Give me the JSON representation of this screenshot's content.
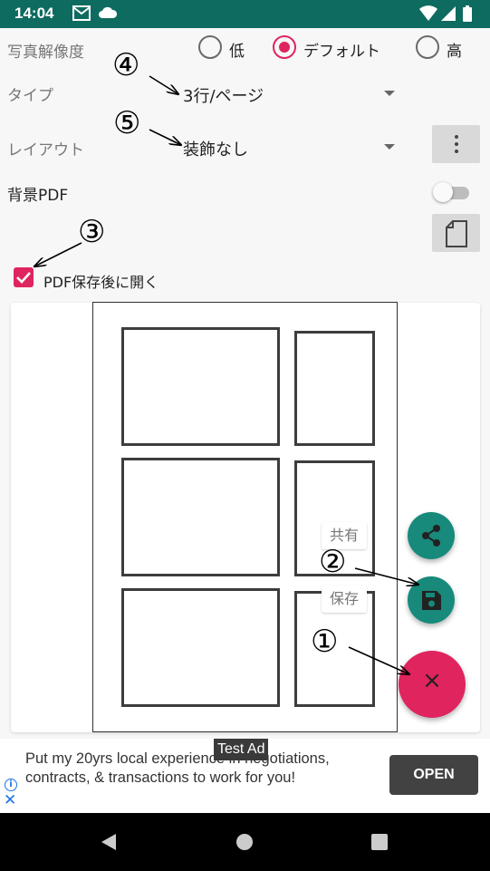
{
  "status_bar": {
    "time": "14:04"
  },
  "photo_resolution": {
    "label": "写真解像度",
    "options": [
      "低",
      "デフォルト",
      "高"
    ],
    "selected": "デフォルト"
  },
  "type_row": {
    "label": "タイプ",
    "value": "3行/ページ"
  },
  "layout_row": {
    "label": "レイアウト",
    "value": "装飾なし"
  },
  "background_pdf": {
    "label": "背景PDF",
    "enabled": false
  },
  "open_after_save": {
    "label": "PDF保存後に開く",
    "checked": true
  },
  "fab_menu": {
    "share_label": "共有",
    "save_label": "保存",
    "close_symbol": "×"
  },
  "callouts": [
    "①",
    "②",
    "③",
    "④",
    "⑤"
  ],
  "ad": {
    "tag": "Test Ad",
    "text": "Put my 20yrs local experience in negotiations, contracts, & transactions to work for you!",
    "button": "OPEN"
  },
  "colors": {
    "status_bar": "#0e6b5f",
    "accent": "#e0245e",
    "fab_teal": "#178a7c"
  }
}
